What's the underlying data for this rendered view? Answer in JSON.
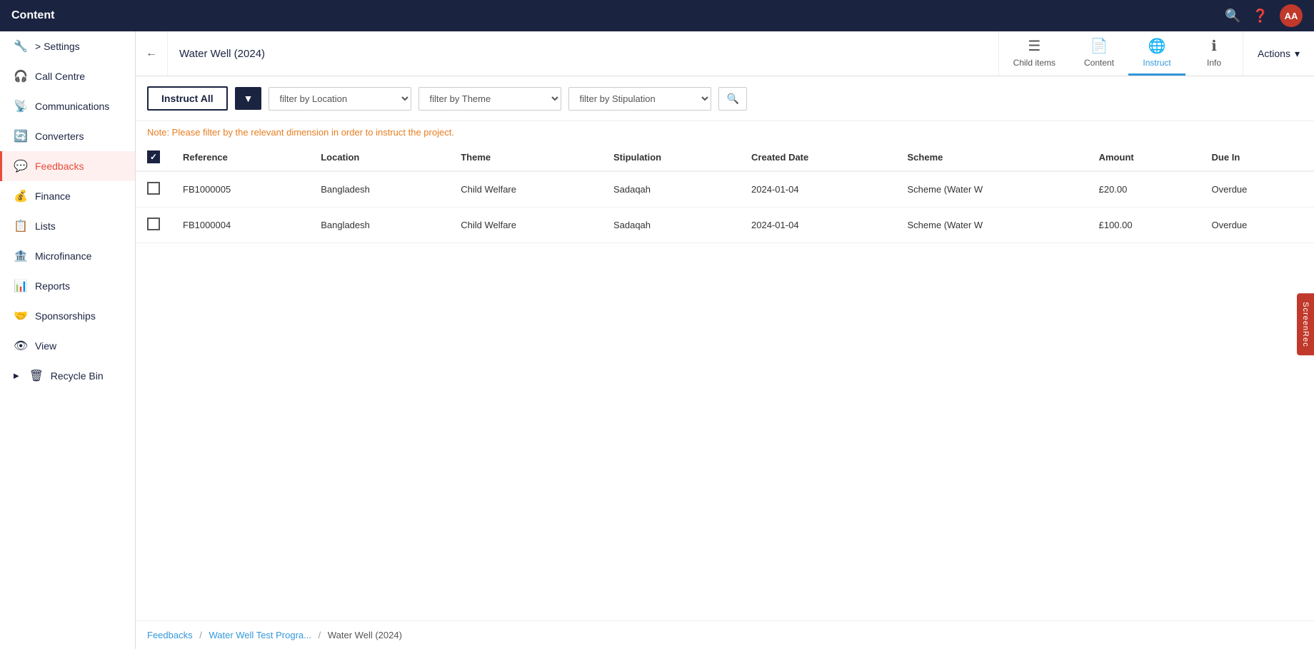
{
  "topbar": {
    "title": "Content",
    "avatar_initials": "AA",
    "search_icon": "🔍",
    "help_icon": "❓"
  },
  "sidebar": {
    "items": [
      {
        "id": "settings",
        "label": "> Settings",
        "icon": "🔧",
        "active": false,
        "has_arrow": false
      },
      {
        "id": "call-centre",
        "label": "Call Centre",
        "icon": "🎧",
        "active": false,
        "has_arrow": false
      },
      {
        "id": "communications",
        "label": "Communications",
        "icon": "📡",
        "active": false,
        "has_arrow": false
      },
      {
        "id": "converters",
        "label": "Converters",
        "icon": "🔄",
        "active": false,
        "has_arrow": false
      },
      {
        "id": "feedbacks",
        "label": "Feedbacks",
        "icon": "💬",
        "active": true,
        "has_arrow": false
      },
      {
        "id": "finance",
        "label": "Finance",
        "icon": "💰",
        "active": false,
        "has_arrow": false
      },
      {
        "id": "lists",
        "label": "Lists",
        "icon": "📋",
        "active": false,
        "has_arrow": false
      },
      {
        "id": "microfinance",
        "label": "Microfinance",
        "icon": "🏦",
        "active": false,
        "has_arrow": false
      },
      {
        "id": "reports",
        "label": "Reports",
        "icon": "📊",
        "active": false,
        "has_arrow": false
      },
      {
        "id": "sponsorships",
        "label": "Sponsorships",
        "icon": "🤝",
        "active": false,
        "has_arrow": false
      },
      {
        "id": "view",
        "label": "View",
        "icon": "👁",
        "active": false,
        "has_arrow": false
      },
      {
        "id": "recycle-bin",
        "label": "Recycle Bin",
        "icon": "🗑",
        "active": false,
        "has_arrow": true
      }
    ]
  },
  "header": {
    "page_title": "Water Well (2024)",
    "back_icon": "←",
    "tabs": [
      {
        "id": "child-items",
        "label": "Child items",
        "icon": "☰",
        "active": false
      },
      {
        "id": "content",
        "label": "Content",
        "icon": "📄",
        "active": false
      },
      {
        "id": "instruct",
        "label": "Instruct",
        "icon": "🌐",
        "active": true
      },
      {
        "id": "info",
        "label": "Info",
        "icon": "ℹ",
        "active": false
      }
    ],
    "actions_label": "Actions",
    "actions_arrow": "▾"
  },
  "toolbar": {
    "instruct_all_label": "Instruct All",
    "filter_icon": "▼",
    "filter_location_placeholder": "filter by Location",
    "filter_theme_placeholder": "filter by Theme",
    "filter_stipulation_placeholder": "filter by Stipulation",
    "search_icon": "🔍"
  },
  "note": {
    "text": "Note: Please filter by the relevant dimension in order to instruct the project."
  },
  "table": {
    "columns": [
      "",
      "Reference",
      "Location",
      "Theme",
      "Stipulation",
      "Created Date",
      "Scheme",
      "Amount",
      "Due In"
    ],
    "rows": [
      {
        "reference": "FB1000005",
        "location": "Bangladesh",
        "theme": "Child Welfare",
        "stipulation": "Sadaqah",
        "created_date": "2024-01-04",
        "scheme": "Scheme (Water W",
        "amount": "£20.00",
        "due_in": "Overdue"
      },
      {
        "reference": "FB1000004",
        "location": "Bangladesh",
        "theme": "Child Welfare",
        "stipulation": "Sadaqah",
        "created_date": "2024-01-04",
        "scheme": "Scheme (Water W",
        "amount": "£100.00",
        "due_in": "Overdue"
      }
    ]
  },
  "breadcrumb": {
    "items": [
      {
        "label": "Feedbacks",
        "link": true
      },
      {
        "label": "Water Well Test Progra...",
        "link": true
      },
      {
        "label": "Water Well (2024)",
        "link": false
      }
    ]
  },
  "side_widget": {
    "label": "ScreenRec"
  }
}
